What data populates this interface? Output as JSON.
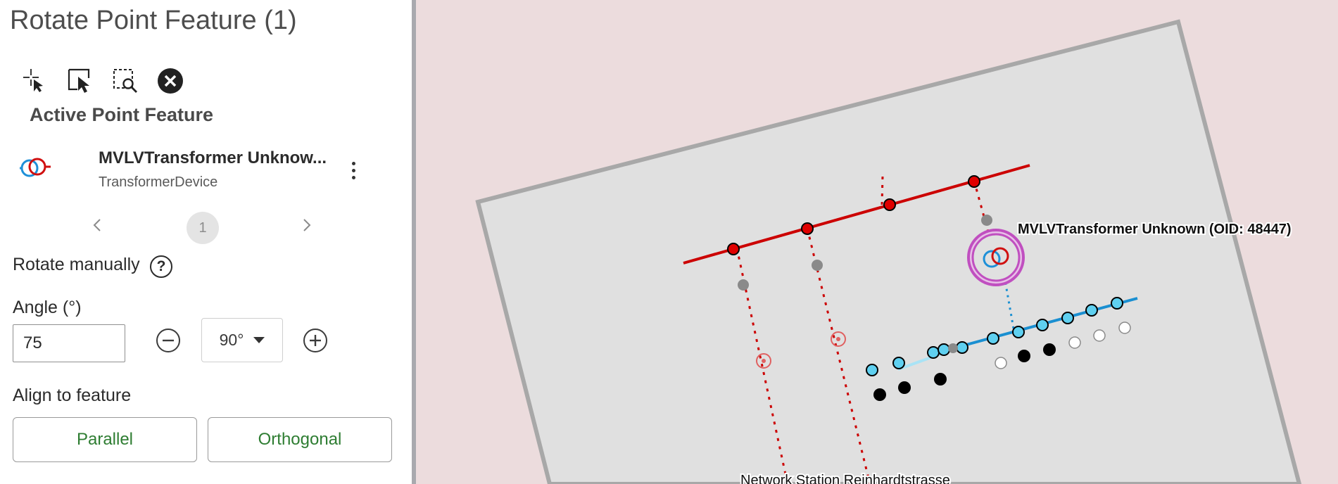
{
  "panel": {
    "title": "Rotate Point Feature (1)",
    "tools": [
      {
        "icon": "pointer-crosshair-icon"
      },
      {
        "icon": "select-arrow-icon"
      },
      {
        "icon": "select-zoom-icon"
      },
      {
        "icon": "clear-selection-icon"
      }
    ],
    "active_feature_heading": "Active Point Feature",
    "feature": {
      "name": "MVLVTransformer Unknow...",
      "subtype": "TransformerDevice",
      "icon": "transformer-icon"
    },
    "pager": {
      "current": "1",
      "prev_icon": "chevron-left-icon",
      "next_icon": "chevron-right-icon"
    },
    "rotate_manually_label": "Rotate manually",
    "help_symbol": "?",
    "angle_label": "Angle (°)",
    "angle_value": "75",
    "increment_value": "90°",
    "align_label": "Align to feature",
    "parallel_label": "Parallel",
    "orthogonal_label": "Orthogonal"
  },
  "map": {
    "selected_feature_label": "MVLVTransformer Unknown (OID: 48447)",
    "station_label": "Network Station Reinhardtstrasse",
    "colors": {
      "background": "#ecdcdd",
      "station_fill": "#e0e0e0",
      "station_border": "#a8a8a8",
      "mv_line": "#cc0000",
      "lv_line": "#1a8fd1",
      "lv_dot": "#5fd0f0",
      "selection_ring": "#c04fc0"
    }
  }
}
